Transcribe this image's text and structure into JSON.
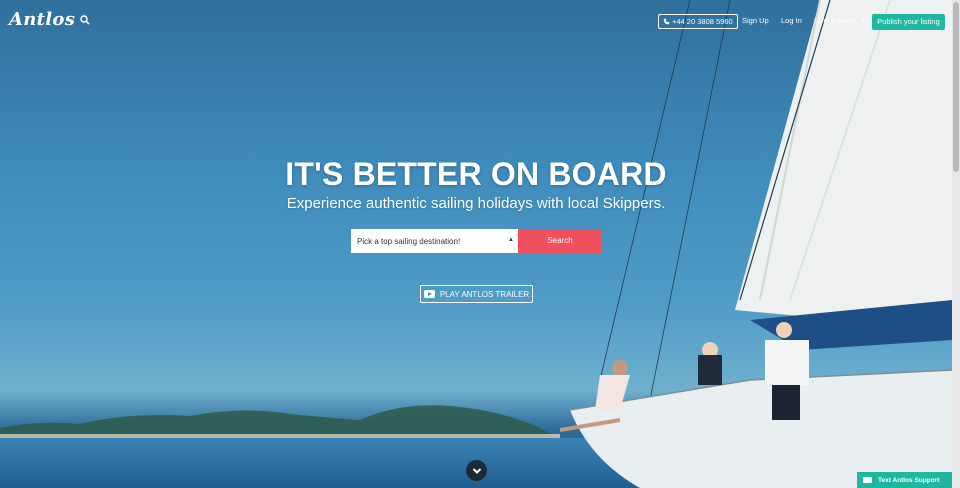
{
  "header": {
    "logo": "Antlos",
    "phone": "+44 20 3808 5960",
    "signup": "Sign Up",
    "login": "Log In",
    "how_it_works": "How it works",
    "publish": "Publish your listing"
  },
  "hero": {
    "headline": "IT'S BETTER ON BOARD",
    "subheadline": "Experience authentic sailing holidays with local Skippers.",
    "destination_placeholder": "Pick a top sailing destination!",
    "search_label": "Search",
    "trailer_label": "PLAY ANTLOS TRAILER"
  },
  "support": {
    "label": "Text Antlos Support"
  },
  "icons": {
    "search": "search-icon",
    "phone": "phone-icon",
    "youtube": "youtube-play-icon",
    "scroll": "chevron-down-icon",
    "mail": "mail-icon"
  },
  "colors": {
    "accent_green": "#1fb79f",
    "search_red": "#f0505e",
    "scroll_button": "#1c2a33"
  }
}
